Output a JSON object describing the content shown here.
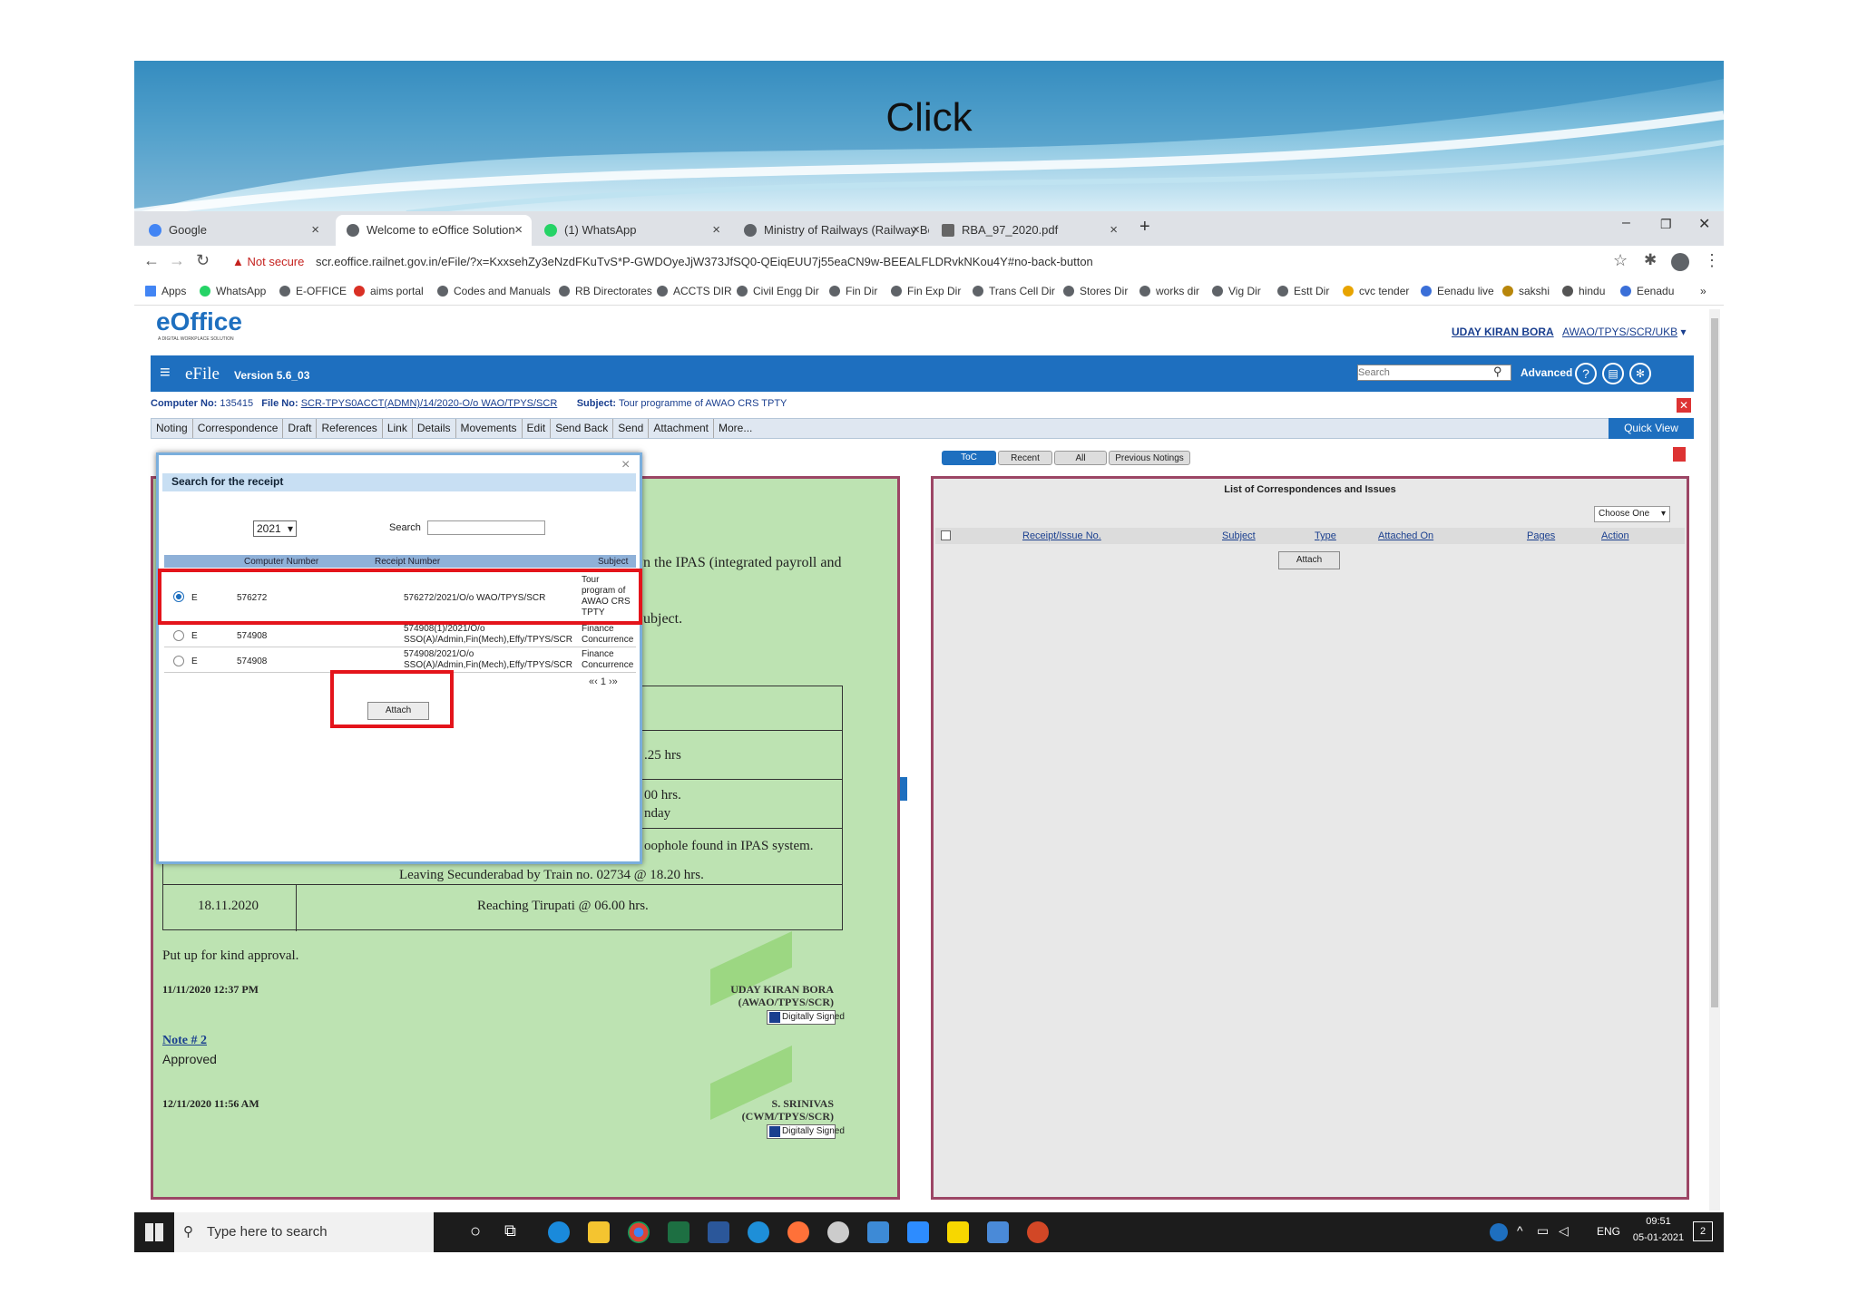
{
  "slide": {
    "title": "Click"
  },
  "browser": {
    "tabs": [
      {
        "label": "Google",
        "icon": "google-icon"
      },
      {
        "label": "Welcome to eOffice Solution",
        "icon": "globe-icon"
      },
      {
        "label": "(1) WhatsApp",
        "icon": "whatsapp-icon"
      },
      {
        "label": "Ministry of Railways (Railway Boa",
        "icon": "globe-icon"
      },
      {
        "label": "RBA_97_2020.pdf",
        "icon": "pdf-icon"
      }
    ],
    "new_tab": "+",
    "window_controls": {
      "minimize": "–",
      "restore": "❐",
      "close": "✕"
    },
    "security_label": "Not secure",
    "url": "scr.eoffice.railnet.gov.in/eFile/?x=KxxsehZy3eNzdFKuTvS*P-GWDOyeJjW373JfSQ0-QEiqEUU7j55eaCN9w-BEEALFLDRvkNKou4Y#no-back-button",
    "bookmarks": [
      "Apps",
      "WhatsApp",
      "E-OFFICE",
      "aims portal",
      "Codes and Manuals",
      "RB Directorates",
      "ACCTS DIR",
      "Civil Engg Dir",
      "Fin Dir",
      "Fin Exp Dir",
      "Trans Cell Dir",
      "Stores Dir",
      "works dir",
      "Vig Dir",
      "Estt Dir",
      "cvc tender",
      "Eenadu live",
      "sakshi",
      "hindu",
      "Eenadu"
    ],
    "bookmarks_more": "»"
  },
  "app": {
    "logo": "eOffice",
    "logo_tagline": "A DIGITAL WORKPLACE SOLUTION",
    "user_name": "UDAY KIRAN BORA",
    "user_role": "AWAO/TPYS/SCR/UKB",
    "product": "eFile",
    "version": "Version 5.6_03",
    "search_placeholder": "Search",
    "advanced": "Advanced",
    "file_info": {
      "computer_no_label": "Computer No:",
      "computer_no": "135415",
      "file_no_label": "File No:",
      "file_no": "SCR-TPYS0ACCT(ADMN)/14/2020-O/o WAO/TPYS/SCR",
      "subject_label": "Subject:",
      "subject": "Tour programme of AWAO CRS TPTY"
    },
    "menu": [
      "Noting",
      "Correspondence",
      "Draft",
      "References",
      "Link",
      "Details",
      "Movements",
      "Edit",
      "Send Back",
      "Send",
      "Attachment",
      "More..."
    ],
    "quick_view": "Quick View",
    "right_tabs": [
      "ToC",
      "Recent",
      "All",
      "Previous Notings"
    ]
  },
  "note_pane": {
    "line1": "n the IPAS (integrated payroll and",
    "line2": "ubject.",
    "row_hrs1": ".25 hrs",
    "row_hrs2a": "00 hrs.",
    "row_hrs2b": "nday",
    "row_loop": "oophole found in IPAS system.",
    "row_leaving": "Leaving Secunderabad by Train no. 02734 @ 18.20 hrs.",
    "row_date": "18.11.2020",
    "row_reach": "Reaching Tirupati @ 06.00 hrs.",
    "approval": "Put up for kind approval.",
    "date1": "11/11/2020 12:37 PM",
    "signer1": "UDAY KIRAN BORA",
    "signer1_role": "(AWAO/TPYS/SCR)",
    "signed": "Digitally Signed",
    "note2": "Note # 2",
    "approved": "Approved",
    "date2": "12/11/2020 11:56 AM",
    "signer2": "S. SRINIVAS",
    "signer2_role": "(CWM/TPYS/SCR)"
  },
  "right_pane": {
    "title": "List of Correspondences and Issues",
    "choose": "Choose One",
    "columns": [
      "Receipt/Issue No.",
      "Subject",
      "Type",
      "Attached On",
      "Pages",
      "Action"
    ],
    "attach": "Attach"
  },
  "dialog": {
    "title": "Search for the receipt",
    "year": "2021",
    "search_label": "Search",
    "columns": [
      "Computer Number",
      "Receipt Number",
      "Subject"
    ],
    "rows": [
      {
        "type": "E",
        "computer": "576272",
        "receipt": "576272/2021/O/o WAO/TPYS/SCR",
        "subject": "Tour program of AWAO CRS TPTY",
        "selected": true
      },
      {
        "type": "E",
        "computer": "574908",
        "receipt": "574908(1)/2021/O/o SSO(A)/Admin,Fin(Mech),Effy/TPYS/SCR",
        "subject": "Finance Concurrence",
        "selected": false
      },
      {
        "type": "E",
        "computer": "574908",
        "receipt": "574908/2021/O/o SSO(A)/Admin,Fin(Mech),Effy/TPYS/SCR",
        "subject": "Finance Concurrence",
        "selected": false
      }
    ],
    "pager": "«‹ 1 ›»",
    "attach": "Attach",
    "close": "×"
  },
  "taskbar": {
    "search_placeholder": "Type here to search",
    "lang": "ENG",
    "time": "09:51",
    "date": "05-01-2021",
    "notif": "2"
  }
}
